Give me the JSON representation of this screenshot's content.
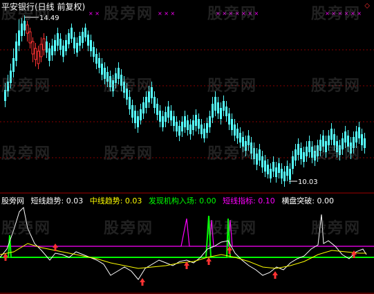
{
  "title": "平安银行(日线 前复权)",
  "high_label": "14.49",
  "low_label": "10.03",
  "indicators": {
    "prefix": "股旁网",
    "short_trend": "短线趋势: 0.03",
    "mid_trend": "中线趋势: 0.03",
    "institution": "发现机构入场: 0.00",
    "short_index": "短线指标: 0.10",
    "breakout": "横盘突破: 0.00"
  },
  "watermark": "股旁网",
  "colors": {
    "up": "#ff3232",
    "down": "#54ffff",
    "short_trend": "#ffffff",
    "mid_trend": "#ffff00",
    "institution": "#00ff00",
    "short_index": "#ff00ff",
    "breakout": "#ffffff",
    "grid": "#aa0000",
    "marker": "#ff3232"
  },
  "icons": {
    "diamond": "diamond-icon"
  }
}
